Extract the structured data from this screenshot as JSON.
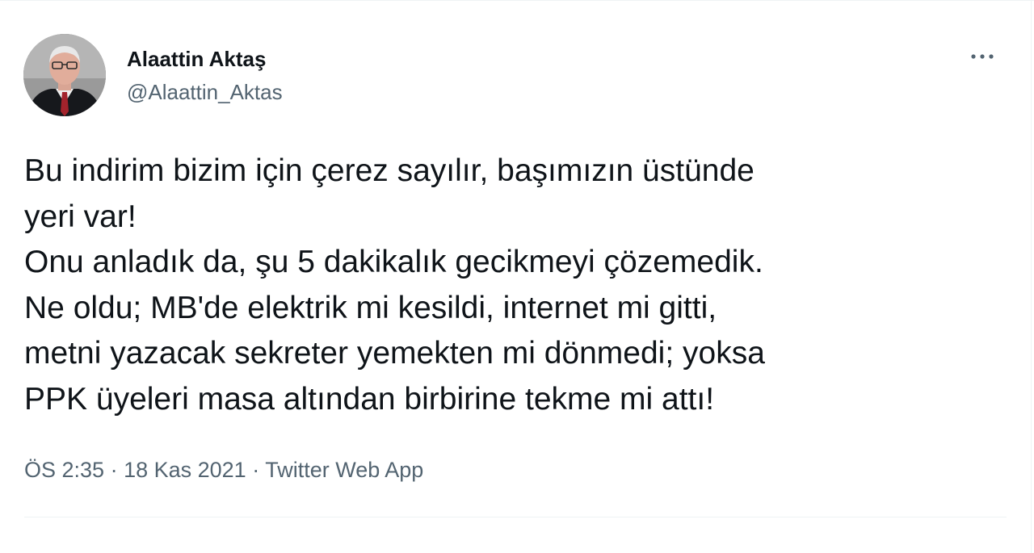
{
  "author": {
    "display_name": "Alaattin Aktaş",
    "handle": "@Alaattin_Aktas"
  },
  "more_icon": "more-horizontal-icon",
  "tweet": {
    "text": "Bu indirim bizim için çerez sayılır, başımızın üstünde\nyeri var!\nOnu anladık da, şu 5 dakikalık gecikmeyi çözemedik.\nNe oldu; MB'de elektrik mi kesildi, internet mi gitti,\nmetni yazacak sekreter yemekten mi dönmedi; yoksa\nPPK üyeleri masa altından birbirine tekme mi attı!"
  },
  "meta": {
    "time": "ÖS 2:35",
    "sep1": " · ",
    "date": "18 Kas 2021",
    "sep2": " · ",
    "source": "Twitter Web App"
  },
  "colors": {
    "text_primary": "#0f1419",
    "text_secondary": "#536471",
    "divider": "#eff3f4"
  }
}
